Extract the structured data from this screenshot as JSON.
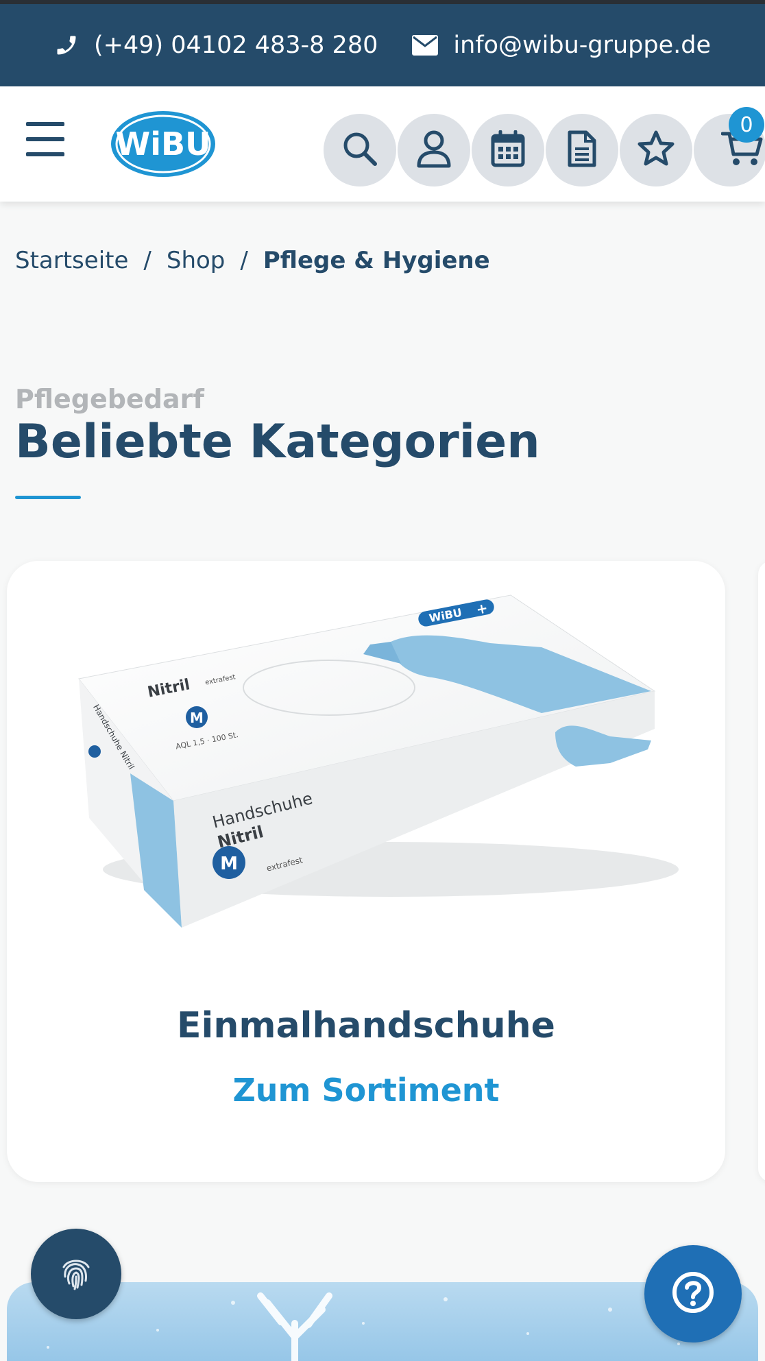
{
  "contact": {
    "phone": "(+49) 04102 483-8 280",
    "email": "info@wibu-gruppe.de"
  },
  "header": {
    "logo_text": "WiBU",
    "cart_count": "0",
    "icons": [
      "menu-icon",
      "search-icon",
      "user-icon",
      "calendar-icon",
      "document-icon",
      "star-icon",
      "cart-icon"
    ]
  },
  "breadcrumb": {
    "items": [
      "Startseite",
      "Shop",
      "Pflege & Hygiene"
    ],
    "separator": "/"
  },
  "section": {
    "eyebrow": "Pflegebedarf",
    "title": "Beliebte Kategorien"
  },
  "card": {
    "title": "Einmalhandschuhe",
    "link": "Zum Sortiment",
    "product": {
      "brand": "WiBU",
      "name_top": "Nitril",
      "name_top_sub": "extrafest",
      "size": "M",
      "spec": "AQL 1,5 · 100 St.",
      "label_line1": "Handschuhe",
      "label_line2": "Nitril",
      "label_sub": "extrafest",
      "side_text": "Handschuhe Nitril"
    }
  },
  "colors": {
    "primary": "#254b6a",
    "accent": "#1f95d3",
    "button_bg": "#dde1e6",
    "page_bg": "#f7f8f8"
  }
}
